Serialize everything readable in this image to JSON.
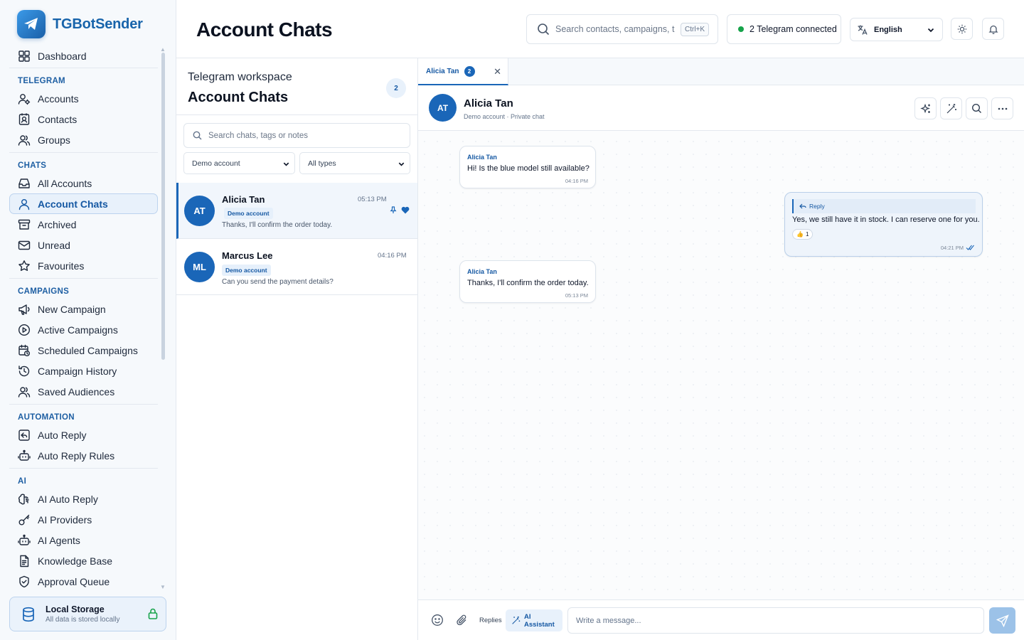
{
  "app": {
    "name": "TGBotSender"
  },
  "sidebar": {
    "items": [
      {
        "type": "item",
        "key": "dashboard",
        "label": "Dashboard",
        "icon": "dashboard-icon"
      },
      {
        "type": "section",
        "label": "TELEGRAM"
      },
      {
        "type": "item",
        "key": "accounts",
        "label": "Accounts",
        "icon": "user-gear-icon"
      },
      {
        "type": "item",
        "key": "contacts",
        "label": "Contacts",
        "icon": "contact-card-icon"
      },
      {
        "type": "item",
        "key": "groups",
        "label": "Groups",
        "icon": "users-icon"
      },
      {
        "type": "section",
        "label": "CHATS"
      },
      {
        "type": "item",
        "key": "all-accounts",
        "label": "All Accounts",
        "icon": "inbox-icon"
      },
      {
        "type": "item",
        "key": "account-chats",
        "label": "Account Chats",
        "icon": "user-icon",
        "active": true
      },
      {
        "type": "item",
        "key": "archived",
        "label": "Archived",
        "icon": "archive-icon"
      },
      {
        "type": "item",
        "key": "unread",
        "label": "Unread",
        "icon": "envelope-icon"
      },
      {
        "type": "item",
        "key": "favourites",
        "label": "Favourites",
        "icon": "star-icon"
      },
      {
        "type": "section",
        "label": "CAMPAIGNS"
      },
      {
        "type": "item",
        "key": "new-campaign",
        "label": "New Campaign",
        "icon": "megaphone-icon"
      },
      {
        "type": "item",
        "key": "active-campaigns",
        "label": "Active Campaigns",
        "icon": "play-circle-icon"
      },
      {
        "type": "item",
        "key": "scheduled-campaigns",
        "label": "Scheduled Campaigns",
        "icon": "calendar-clock-icon"
      },
      {
        "type": "item",
        "key": "campaign-history",
        "label": "Campaign History",
        "icon": "history-icon"
      },
      {
        "type": "item",
        "key": "saved-audiences",
        "label": "Saved Audiences",
        "icon": "users-icon"
      },
      {
        "type": "section",
        "label": "AUTOMATION"
      },
      {
        "type": "item",
        "key": "auto-reply",
        "label": "Auto Reply",
        "icon": "reply-box-icon"
      },
      {
        "type": "item",
        "key": "auto-reply-rules",
        "label": "Auto Reply Rules",
        "icon": "bot-icon"
      },
      {
        "type": "section",
        "label": "AI"
      },
      {
        "type": "item",
        "key": "ai-auto-reply",
        "label": "AI Auto Reply",
        "icon": "brain-icon"
      },
      {
        "type": "item",
        "key": "ai-providers",
        "label": "AI Providers",
        "icon": "key-icon"
      },
      {
        "type": "item",
        "key": "ai-agents",
        "label": "AI Agents",
        "icon": "bot-icon"
      },
      {
        "type": "item",
        "key": "knowledge-base",
        "label": "Knowledge Base",
        "icon": "document-icon"
      },
      {
        "type": "item",
        "key": "approval-queue",
        "label": "Approval Queue",
        "icon": "shield-check-icon"
      }
    ],
    "storage": {
      "title": "Local Storage",
      "subtitle": "All data is stored locally"
    }
  },
  "header": {
    "title": "Account Chats",
    "search_placeholder": "Search contacts, campaigns, t...",
    "search_shortcut": "Ctrl+K",
    "connection_status": "2 Telegram connected",
    "language": "English",
    "status_color": "#16a34a"
  },
  "chat_list": {
    "eyebrow": "Telegram workspace",
    "title": "Account Chats",
    "count": "2",
    "search_placeholder": "Search chats, tags or notes",
    "filter_account": "Demo account",
    "filter_type": "All types",
    "chats": [
      {
        "initials": "AT",
        "name": "Alicia Tan",
        "time": "05:13 PM",
        "tag": "Demo account",
        "preview": "Thanks, I'll confirm the order today.",
        "active": true,
        "pinned": true,
        "favourite": true
      },
      {
        "initials": "ML",
        "name": "Marcus Lee",
        "time": "04:16 PM",
        "tag": "Demo account",
        "preview": "Can you send the payment details?",
        "active": false
      }
    ]
  },
  "conversation": {
    "tab": {
      "label": "Alicia Tan",
      "badge": "2"
    },
    "contact": {
      "initials": "AT",
      "name": "Alicia Tan",
      "subtitle": "Demo account · Private chat"
    },
    "messages": [
      {
        "direction": "in",
        "sender": "Alicia Tan",
        "text": "Hi! Is the blue model still available?",
        "time": "04:16 PM"
      },
      {
        "direction": "out",
        "reply_label": "Reply",
        "text": "Yes, we still have it in stock. I can reserve one for you.",
        "reaction_emoji": "👍",
        "reaction_count": "1",
        "time": "04:21 PM"
      },
      {
        "direction": "in",
        "sender": "Alicia Tan",
        "text": "Thanks, I'll confirm the order today.",
        "time": "05:13 PM"
      }
    ],
    "composer": {
      "replies_label": "Replies",
      "ai_label": "AI Assistant",
      "placeholder": "Write a message..."
    }
  },
  "colors": {
    "accent": "#1a66b8",
    "brand": "#1864ab"
  }
}
